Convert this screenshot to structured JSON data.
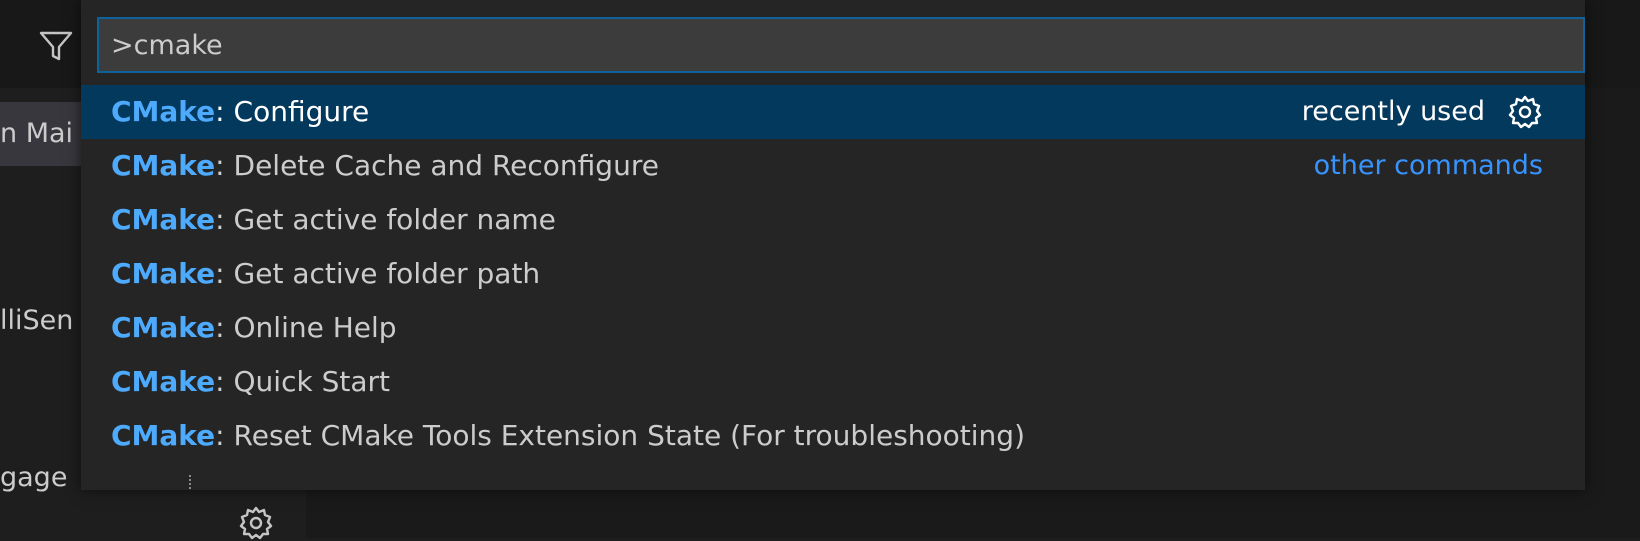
{
  "background": {
    "sidebar_items": [
      "n Mai",
      "lliSen",
      "gage"
    ]
  },
  "quick_pick": {
    "input_value": ">cmake",
    "items": [
      {
        "category": "CMake",
        "separator": ": ",
        "label": "Configure",
        "right_label": "recently used",
        "selected": true
      },
      {
        "category": "CMake",
        "separator": ": ",
        "label": "Delete Cache and Reconfigure",
        "right_label": "other commands",
        "selected": false
      },
      {
        "category": "CMake",
        "separator": ": ",
        "label": "Get active folder name",
        "selected": false
      },
      {
        "category": "CMake",
        "separator": ": ",
        "label": "Get active folder path",
        "selected": false
      },
      {
        "category": "CMake",
        "separator": ": ",
        "label": "Online Help",
        "selected": false
      },
      {
        "category": "CMake",
        "separator": ": ",
        "label": "Quick Start",
        "selected": false
      },
      {
        "category": "CMake",
        "separator": ": ",
        "label": "Reset CMake Tools Extension State (For troubleshooting)",
        "selected": false
      }
    ]
  },
  "colors": {
    "accent": "#0e639c",
    "category_blue": "#4daafc",
    "link_blue": "#3794ff",
    "selected_bg": "#04395e"
  },
  "icons": [
    "filter-icon",
    "gear-icon"
  ]
}
